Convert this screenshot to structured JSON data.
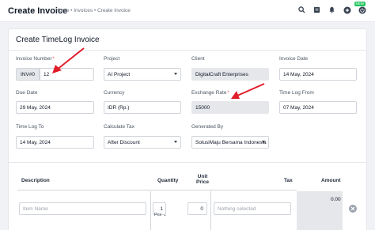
{
  "header": {
    "title": "Create Invoice",
    "breadcrumb": "Home • Invoices • Create Invoice",
    "badge": "NEW"
  },
  "colors": {
    "accent": "#ef4444",
    "readonly": "#e5e7eb",
    "annotation_arrow": "#e11d2a"
  },
  "form": {
    "title": "Create TimeLog Invoice",
    "invoice_number": {
      "label": "Invoice Number",
      "required": "*",
      "prefix": "INV#0",
      "value": "12"
    },
    "project": {
      "label": "Project",
      "value": "AI Project"
    },
    "client": {
      "label": "Client",
      "value": "DigitalCraft Enterprises"
    },
    "invoice_date": {
      "label": "Invoice Date",
      "value": "14 May, 2024"
    },
    "due_date": {
      "label": "Due Date",
      "value": "29 May, 2024"
    },
    "currency": {
      "label": "Currency",
      "value": "IDR (Rp.)"
    },
    "exchange_rate": {
      "label": "Exchange Rate",
      "required": "*",
      "value": "15000"
    },
    "timelog_from": {
      "label": "Time Log From",
      "value": "07 May, 2024"
    },
    "timelog_to": {
      "label": "Time Log To",
      "value": "14 May, 2024"
    },
    "calculate_tax": {
      "label": "Calculate Tax",
      "value": "After Discount"
    },
    "generated_by": {
      "label": "Generated By",
      "value": "SolusiMaju Bersama Indonesia"
    }
  },
  "items_table": {
    "headers": {
      "description": "Description",
      "quantity": "Quantity",
      "unit_price_1": "Unit",
      "unit_price_2": "Price",
      "tax": "Tax",
      "amount": "Amount"
    },
    "row": {
      "item_name_placeholder": "Item Name",
      "quantity": "1",
      "unit": "Pcs",
      "unit_price": "0",
      "tax_placeholder": "Nothing selected",
      "amount": "0.00"
    }
  }
}
